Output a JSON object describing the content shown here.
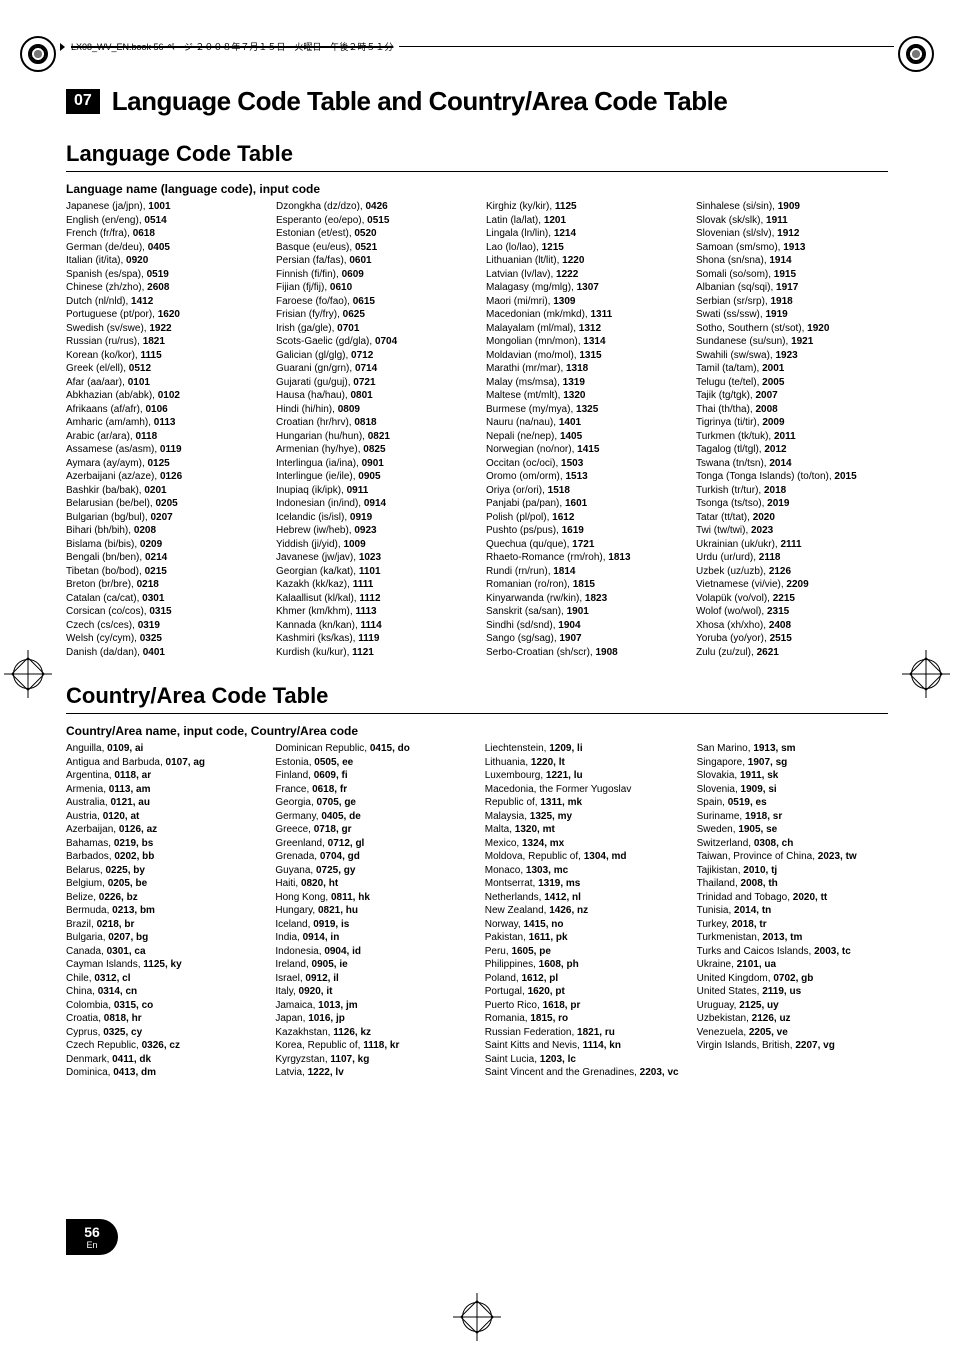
{
  "header": {
    "text": "LX08_WV_EN.book  56 ページ  ２００８年７月１５日　火曜日　午後２時５１分"
  },
  "chapter": {
    "num": "07",
    "title": "Language Code Table and Country/Area Code Table"
  },
  "sections": {
    "lang": {
      "title": "Language Code Table",
      "heading": "Language name (language code), input code"
    },
    "country": {
      "title": "Country/Area Code Table",
      "heading": "Country/Area name, input code, Country/Area code"
    }
  },
  "lang": [
    [
      [
        "Japanese (ja/jpn), ",
        "1001"
      ],
      [
        "English (en/eng), ",
        "0514"
      ],
      [
        "French (fr/fra), ",
        "0618"
      ],
      [
        "German (de/deu), ",
        "0405"
      ],
      [
        "Italian (it/ita), ",
        "0920"
      ],
      [
        "Spanish (es/spa), ",
        "0519"
      ],
      [
        "Chinese (zh/zho), ",
        "2608"
      ],
      [
        "Dutch (nl/nld), ",
        "1412"
      ],
      [
        "Portuguese (pt/por), ",
        "1620"
      ],
      [
        "Swedish (sv/swe), ",
        "1922"
      ],
      [
        "Russian (ru/rus), ",
        "1821"
      ],
      [
        "Korean (ko/kor), ",
        "1115"
      ],
      [
        "Greek (el/ell), ",
        "0512"
      ],
      [
        "Afar (aa/aar), ",
        "0101"
      ],
      [
        "Abkhazian (ab/abk), ",
        "0102"
      ],
      [
        "Afrikaans (af/afr), ",
        "0106"
      ],
      [
        "Amharic (am/amh), ",
        "0113"
      ],
      [
        "Arabic (ar/ara), ",
        "0118"
      ],
      [
        "Assamese (as/asm), ",
        "0119"
      ],
      [
        "Aymara (ay/aym), ",
        "0125"
      ],
      [
        "Azerbaijani (az/aze), ",
        "0126"
      ],
      [
        "Bashkir (ba/bak), ",
        "0201"
      ],
      [
        "Belarusian (be/bel), ",
        "0205"
      ],
      [
        "Bulgarian (bg/bul), ",
        "0207"
      ],
      [
        "Bihari (bh/bih), ",
        "0208"
      ],
      [
        "Bislama (bi/bis), ",
        "0209"
      ],
      [
        "Bengali (bn/ben), ",
        "0214"
      ],
      [
        "Tibetan (bo/bod), ",
        "0215"
      ],
      [
        "Breton (br/bre), ",
        "0218"
      ],
      [
        "Catalan (ca/cat), ",
        "0301"
      ],
      [
        "Corsican (co/cos), ",
        "0315"
      ],
      [
        "Czech (cs/ces), ",
        "0319"
      ],
      [
        "Welsh (cy/cym), ",
        "0325"
      ],
      [
        "Danish (da/dan), ",
        "0401"
      ]
    ],
    [
      [
        "Dzongkha (dz/dzo), ",
        "0426"
      ],
      [
        "Esperanto (eo/epo), ",
        "0515"
      ],
      [
        "Estonian (et/est), ",
        "0520"
      ],
      [
        "Basque (eu/eus), ",
        "0521"
      ],
      [
        "Persian (fa/fas), ",
        "0601"
      ],
      [
        "Finnish (fi/fin), ",
        "0609"
      ],
      [
        "Fijian (fj/fij), ",
        "0610"
      ],
      [
        "Faroese (fo/fao), ",
        "0615"
      ],
      [
        "Frisian (fy/fry), ",
        "0625"
      ],
      [
        "Irish (ga/gle), ",
        "0701"
      ],
      [
        "Scots-Gaelic (gd/gla), ",
        "0704"
      ],
      [
        "Galician (gl/glg), ",
        "0712"
      ],
      [
        "Guarani (gn/grn), ",
        "0714"
      ],
      [
        "Gujarati (gu/guj), ",
        "0721"
      ],
      [
        "Hausa (ha/hau), ",
        "0801"
      ],
      [
        "Hindi (hi/hin), ",
        "0809"
      ],
      [
        "Croatian (hr/hrv), ",
        "0818"
      ],
      [
        "Hungarian (hu/hun), ",
        "0821"
      ],
      [
        "Armenian (hy/hye), ",
        "0825"
      ],
      [
        "Interlingua (ia/ina), ",
        "0901"
      ],
      [
        "Interlingue (ie/ile), ",
        "0905"
      ],
      [
        "Inupiaq (ik/ipk), ",
        "0911"
      ],
      [
        "Indonesian (in/ind), ",
        "0914"
      ],
      [
        "Icelandic (is/isl), ",
        "0919"
      ],
      [
        "Hebrew (iw/heb), ",
        "0923"
      ],
      [
        "Yiddish (ji/yid), ",
        "1009"
      ],
      [
        "Javanese (jw/jav), ",
        "1023"
      ],
      [
        "Georgian (ka/kat), ",
        "1101"
      ],
      [
        "Kazakh (kk/kaz), ",
        "1111"
      ],
      [
        "Kalaallisut (kl/kal), ",
        "1112"
      ],
      [
        "Khmer (km/khm), ",
        "1113"
      ],
      [
        "Kannada (kn/kan), ",
        "1114"
      ],
      [
        "Kashmiri (ks/kas), ",
        "1119"
      ],
      [
        "Kurdish (ku/kur), ",
        "1121"
      ]
    ],
    [
      [
        "Kirghiz (ky/kir), ",
        "1125"
      ],
      [
        "Latin (la/lat), ",
        "1201"
      ],
      [
        "Lingala (ln/lin), ",
        "1214"
      ],
      [
        "Lao (lo/lao), ",
        "1215"
      ],
      [
        "Lithuanian (lt/lit), ",
        "1220"
      ],
      [
        "Latvian (lv/lav), ",
        "1222"
      ],
      [
        "Malagasy (mg/mlg), ",
        "1307"
      ],
      [
        "Maori (mi/mri), ",
        "1309"
      ],
      [
        "Macedonian (mk/mkd), ",
        "1311"
      ],
      [
        "Malayalam (ml/mal), ",
        "1312"
      ],
      [
        "Mongolian (mn/mon), ",
        "1314"
      ],
      [
        "Moldavian (mo/mol), ",
        "1315"
      ],
      [
        "Marathi (mr/mar), ",
        "1318"
      ],
      [
        "Malay (ms/msa), ",
        "1319"
      ],
      [
        "Maltese (mt/mlt), ",
        "1320"
      ],
      [
        "Burmese (my/mya), ",
        "1325"
      ],
      [
        "Nauru (na/nau), ",
        "1401"
      ],
      [
        "Nepali (ne/nep), ",
        "1405"
      ],
      [
        "Norwegian (no/nor), ",
        "1415"
      ],
      [
        "Occitan (oc/oci), ",
        "1503"
      ],
      [
        "Oromo (om/orm), ",
        "1513"
      ],
      [
        "Oriya (or/ori), ",
        "1518"
      ],
      [
        "Panjabi (pa/pan), ",
        "1601"
      ],
      [
        "Polish (pl/pol), ",
        "1612"
      ],
      [
        "Pushto (ps/pus), ",
        "1619"
      ],
      [
        "Quechua (qu/que), ",
        "1721"
      ],
      [
        "Rhaeto-Romance (rm/roh), ",
        "1813"
      ],
      [
        "Rundi (rn/run), ",
        "1814"
      ],
      [
        "Romanian (ro/ron), ",
        "1815"
      ],
      [
        "Kinyarwanda (rw/kin), ",
        "1823"
      ],
      [
        "Sanskrit (sa/san), ",
        "1901"
      ],
      [
        "Sindhi (sd/snd), ",
        "1904"
      ],
      [
        "Sango (sg/sag), ",
        "1907"
      ],
      [
        "Serbo-Croatian (sh/scr), ",
        "1908"
      ]
    ],
    [
      [
        "Sinhalese (si/sin), ",
        "1909"
      ],
      [
        "Slovak (sk/slk), ",
        "1911"
      ],
      [
        "Slovenian (sl/slv), ",
        "1912"
      ],
      [
        "Samoan (sm/smo), ",
        "1913"
      ],
      [
        "Shona (sn/sna), ",
        "1914"
      ],
      [
        "Somali (so/som), ",
        "1915"
      ],
      [
        "Albanian (sq/sqi), ",
        "1917"
      ],
      [
        "Serbian (sr/srp), ",
        "1918"
      ],
      [
        "Swati (ss/ssw), ",
        "1919"
      ],
      [
        "Sotho, Southern (st/sot), ",
        "1920"
      ],
      [
        "Sundanese (su/sun), ",
        "1921"
      ],
      [
        "Swahili (sw/swa), ",
        "1923"
      ],
      [
        "Tamil (ta/tam), ",
        "2001"
      ],
      [
        "Telugu (te/tel), ",
        "2005"
      ],
      [
        "Tajik (tg/tgk), ",
        "2007"
      ],
      [
        "Thai (th/tha), ",
        "2008"
      ],
      [
        "Tigrinya (ti/tir), ",
        "2009"
      ],
      [
        "Turkmen (tk/tuk), ",
        "2011"
      ],
      [
        "Tagalog (tl/tgl), ",
        "2012"
      ],
      [
        "Tswana (tn/tsn), ",
        "2014"
      ],
      [
        "Tonga (Tonga Islands) (to/ton), ",
        "2015"
      ],
      [
        "Turkish (tr/tur), ",
        "2018"
      ],
      [
        "Tsonga (ts/tso), ",
        "2019"
      ],
      [
        "Tatar (tt/tat), ",
        "2020"
      ],
      [
        "Twi (tw/twi), ",
        "2023"
      ],
      [
        "Ukrainian (uk/ukr), ",
        "2111"
      ],
      [
        "Urdu (ur/urd), ",
        "2118"
      ],
      [
        "Uzbek (uz/uzb), ",
        "2126"
      ],
      [
        "Vietnamese (vi/vie), ",
        "2209"
      ],
      [
        "Volapük (vo/vol), ",
        "2215"
      ],
      [
        "Wolof (wo/wol), ",
        "2315"
      ],
      [
        "Xhosa (xh/xho), ",
        "2408"
      ],
      [
        "Yoruba (yo/yor), ",
        "2515"
      ],
      [
        "Zulu (zu/zul), ",
        "2621"
      ]
    ]
  ],
  "country": [
    [
      [
        "Anguilla, ",
        "0109, ai"
      ],
      [
        "Antigua and Barbuda, ",
        "0107, ag"
      ],
      [
        "Argentina, ",
        "0118, ar"
      ],
      [
        "Armenia, ",
        "0113, am"
      ],
      [
        "Australia, ",
        "0121, au"
      ],
      [
        "Austria, ",
        "0120, at"
      ],
      [
        "Azerbaijan, ",
        "0126, az"
      ],
      [
        "Bahamas, ",
        "0219, bs"
      ],
      [
        "Barbados, ",
        "0202, bb"
      ],
      [
        "Belarus, ",
        "0225, by"
      ],
      [
        "Belgium, ",
        "0205, be"
      ],
      [
        "Belize, ",
        "0226, bz"
      ],
      [
        "Bermuda, ",
        "0213, bm"
      ],
      [
        "Brazil, ",
        "0218, br"
      ],
      [
        "Bulgaria, ",
        "0207, bg"
      ],
      [
        "Canada, ",
        "0301, ca"
      ],
      [
        "Cayman Islands, ",
        "1125, ky"
      ],
      [
        "Chile, ",
        "0312, cl"
      ],
      [
        "China, ",
        "0314, cn"
      ],
      [
        "Colombia, ",
        "0315, co"
      ],
      [
        "Croatia, ",
        "0818, hr"
      ],
      [
        "Cyprus, ",
        "0325, cy"
      ],
      [
        "Czech Republic, ",
        "0326, cz"
      ],
      [
        "Denmark, ",
        "0411, dk"
      ],
      [
        "Dominica, ",
        "0413, dm"
      ]
    ],
    [
      [
        "Dominican Republic, ",
        "0415, do"
      ],
      [
        "Estonia, ",
        "0505, ee"
      ],
      [
        "Finland, ",
        "0609, fi"
      ],
      [
        "France, ",
        "0618, fr"
      ],
      [
        "Georgia, ",
        "0705, ge"
      ],
      [
        "Germany, ",
        "0405, de"
      ],
      [
        "Greece, ",
        "0718, gr"
      ],
      [
        "Greenland, ",
        "0712, gl"
      ],
      [
        "Grenada, ",
        "0704, gd"
      ],
      [
        "Guyana, ",
        "0725, gy"
      ],
      [
        "Haiti, ",
        "0820, ht"
      ],
      [
        "Hong Kong, ",
        "0811, hk"
      ],
      [
        "Hungary, ",
        "0821, hu"
      ],
      [
        "Iceland, ",
        "0919, is"
      ],
      [
        "India, ",
        "0914, in"
      ],
      [
        "Indonesia, ",
        "0904, id"
      ],
      [
        "Ireland, ",
        "0905, ie"
      ],
      [
        "Israel, ",
        "0912, il"
      ],
      [
        "Italy, ",
        "0920, it"
      ],
      [
        "Jamaica, ",
        "1013, jm"
      ],
      [
        "Japan, ",
        "1016, jp"
      ],
      [
        "Kazakhstan, ",
        "1126, kz"
      ],
      [
        "Korea, Republic of, ",
        "1118, kr"
      ],
      [
        "Kyrgyzstan, ",
        "1107, kg"
      ],
      [
        "Latvia, ",
        "1222, lv"
      ]
    ],
    [
      [
        "Liechtenstein, ",
        "1209, li"
      ],
      [
        "Lithuania, ",
        "1220, lt"
      ],
      [
        "Luxembourg, ",
        "1221, lu"
      ],
      [
        "Macedonia, the Former Yugoslav\n   Republic of, ",
        "1311, mk"
      ],
      [
        "Malaysia, ",
        "1325, my"
      ],
      [
        "Malta, ",
        "1320, mt"
      ],
      [
        "Mexico, ",
        "1324, mx"
      ],
      [
        "Moldova, Republic of, ",
        "1304, md"
      ],
      [
        "Monaco, ",
        "1303, mc"
      ],
      [
        "Montserrat, ",
        "1319, ms"
      ],
      [
        "Netherlands, ",
        "1412, nl"
      ],
      [
        "New Zealand, ",
        "1426, nz"
      ],
      [
        "Norway, ",
        "1415, no"
      ],
      [
        "Pakistan, ",
        "1611, pk"
      ],
      [
        "Peru, ",
        "1605, pe"
      ],
      [
        "Philippines, ",
        "1608, ph"
      ],
      [
        "Poland, ",
        "1612, pl"
      ],
      [
        "Portugal, ",
        "1620, pt"
      ],
      [
        "Puerto Rico, ",
        "1618, pr"
      ],
      [
        "Romania, ",
        "1815, ro"
      ],
      [
        "Russian Federation, ",
        "1821, ru"
      ],
      [
        "Saint Kitts and Nevis, ",
        "1114, kn"
      ],
      [
        "Saint Lucia, ",
        "1203, lc"
      ],
      [
        "Saint Vincent and the Grenadines, ",
        "2203, vc"
      ]
    ],
    [
      [
        "San Marino, ",
        "1913, sm"
      ],
      [
        "Singapore, ",
        "1907, sg"
      ],
      [
        "Slovakia, ",
        "1911, sk"
      ],
      [
        "Slovenia, ",
        "1909, si"
      ],
      [
        "Spain, ",
        "0519, es"
      ],
      [
        "Suriname, ",
        "1918, sr"
      ],
      [
        "Sweden, ",
        "1905, se"
      ],
      [
        "Switzerland, ",
        "0308, ch"
      ],
      [
        "Taiwan, Province of China, ",
        "2023, tw"
      ],
      [
        "Tajikistan, ",
        "2010, tj"
      ],
      [
        "Thailand, ",
        "2008, th"
      ],
      [
        "Trinidad and Tobago, ",
        "2020, tt"
      ],
      [
        "Tunisia, ",
        "2014, tn"
      ],
      [
        "Turkey, ",
        "2018, tr"
      ],
      [
        "Turkmenistan, ",
        "2013, tm"
      ],
      [
        "Turks and Caicos Islands, ",
        "2003, tc"
      ],
      [
        "Ukraine, ",
        "2101, ua"
      ],
      [
        "United Kingdom, ",
        "0702, gb"
      ],
      [
        "United States, ",
        "2119, us"
      ],
      [
        "Uruguay, ",
        "2125, uy"
      ],
      [
        "Uzbekistan, ",
        "2126, uz"
      ],
      [
        "Venezuela, ",
        "2205, ve"
      ],
      [
        "Virgin Islands, British, ",
        "2207, vg"
      ]
    ]
  ],
  "page": {
    "num": "56",
    "sub": "En"
  }
}
